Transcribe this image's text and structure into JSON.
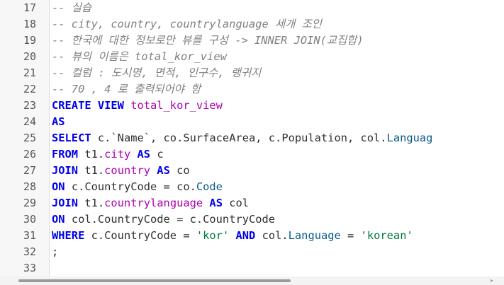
{
  "editor": {
    "lines": [
      {
        "num": "17",
        "tokens": [
          {
            "t": "cm",
            "v": "-- 실습"
          }
        ]
      },
      {
        "num": "18",
        "tokens": [
          {
            "t": "cm",
            "v": "-- city, country, countrylanguage 세개 조인"
          }
        ]
      },
      {
        "num": "19",
        "tokens": [
          {
            "t": "cm",
            "v": "-- 한국에 대한 정보로만 뷰를 구성 -> INNER JOIN(교집합)"
          }
        ]
      },
      {
        "num": "20",
        "tokens": [
          {
            "t": "cm",
            "v": "-- 뷰의 이름은 total_kor_view"
          }
        ]
      },
      {
        "num": "21",
        "tokens": [
          {
            "t": "cm",
            "v": "-- 컬럼 : 도시명, 면적, 인구수, 랭귀지"
          }
        ]
      },
      {
        "num": "22",
        "tokens": [
          {
            "t": "cm",
            "v": "-- 70 , 4 로 출력되어야 함"
          }
        ]
      },
      {
        "num": "23",
        "tokens": [
          {
            "t": "kw",
            "v": "CREATE VIEW "
          },
          {
            "t": "nm",
            "v": "total_kor_view"
          }
        ]
      },
      {
        "num": "24",
        "tokens": [
          {
            "t": "kw",
            "v": "AS"
          }
        ]
      },
      {
        "num": "25",
        "tokens": [
          {
            "t": "kw",
            "v": "SELECT "
          },
          {
            "t": "pl",
            "v": "c.`Name`, co.SurfaceArea, c.Population, col."
          },
          {
            "t": "fd",
            "v": "Languag"
          }
        ]
      },
      {
        "num": "26",
        "tokens": [
          {
            "t": "kw",
            "v": "FROM "
          },
          {
            "t": "pl",
            "v": "t1."
          },
          {
            "t": "nm",
            "v": "city"
          },
          {
            "t": "kw",
            "v": " AS "
          },
          {
            "t": "pl",
            "v": "c"
          }
        ]
      },
      {
        "num": "27",
        "tokens": [
          {
            "t": "kw",
            "v": "JOIN "
          },
          {
            "t": "pl",
            "v": "t1."
          },
          {
            "t": "nm",
            "v": "country"
          },
          {
            "t": "kw",
            "v": " AS "
          },
          {
            "t": "pl",
            "v": "co"
          }
        ]
      },
      {
        "num": "28",
        "tokens": [
          {
            "t": "kw",
            "v": "ON "
          },
          {
            "t": "pl",
            "v": "c.CountryCode = co."
          },
          {
            "t": "fd",
            "v": "Code"
          }
        ]
      },
      {
        "num": "29",
        "tokens": [
          {
            "t": "kw",
            "v": "JOIN "
          },
          {
            "t": "pl",
            "v": "t1."
          },
          {
            "t": "nm",
            "v": "countrylanguage"
          },
          {
            "t": "kw",
            "v": " AS "
          },
          {
            "t": "pl",
            "v": "col"
          }
        ]
      },
      {
        "num": "30",
        "tokens": [
          {
            "t": "kw",
            "v": "ON "
          },
          {
            "t": "pl",
            "v": "col.CountryCode = c.CountryCode"
          }
        ]
      },
      {
        "num": "31",
        "tokens": [
          {
            "t": "kw",
            "v": "WHERE "
          },
          {
            "t": "pl",
            "v": "c.CountryCode = "
          },
          {
            "t": "st",
            "v": "'kor'"
          },
          {
            "t": "kw",
            "v": " AND "
          },
          {
            "t": "pl",
            "v": "col."
          },
          {
            "t": "fd",
            "v": "Language"
          },
          {
            "t": "pl",
            "v": " = "
          },
          {
            "t": "st",
            "v": "'korean'"
          }
        ]
      },
      {
        "num": "32",
        "tokens": [
          {
            "t": "op",
            "v": ";"
          }
        ]
      },
      {
        "num": "33",
        "tokens": []
      }
    ]
  },
  "colors": {
    "comment": "#808080",
    "keyword": "#0000ee",
    "identifier": "#b000b0",
    "field": "#0a5a8c",
    "string": "#007a3d",
    "gutter_bg": "#f7f7f7"
  }
}
